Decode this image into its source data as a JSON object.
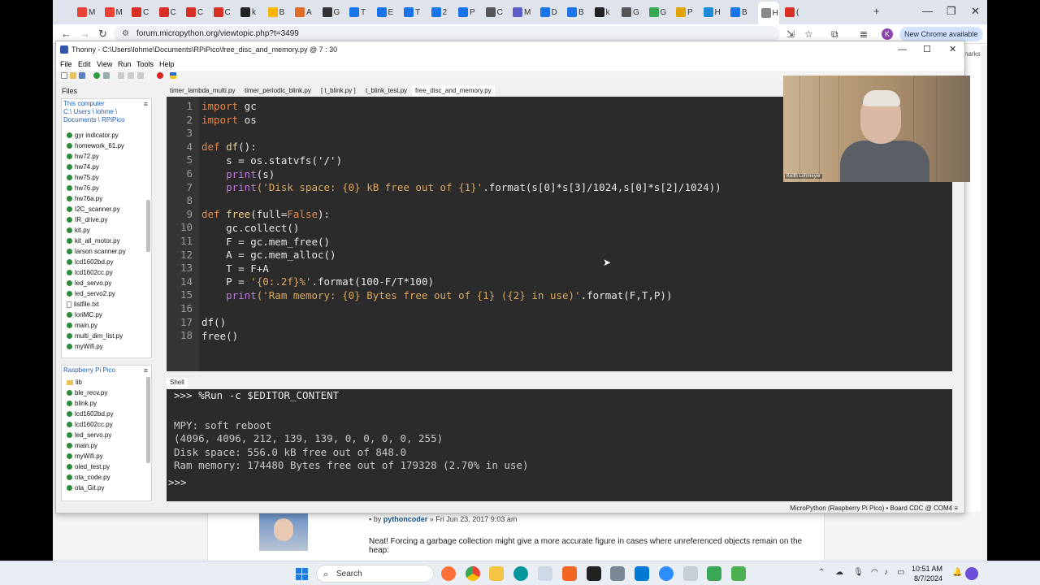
{
  "browser": {
    "url": "forum.micropython.org/viewtopic.php?t=3499",
    "new_chrome": "New Chrome available",
    "profile_initial": "K",
    "tabs": [
      "M",
      "M",
      "C",
      "C",
      "C",
      "C",
      "k",
      "B",
      "A",
      "G",
      "T",
      "E",
      "T",
      "2",
      "P",
      "C",
      "M",
      "D",
      "B",
      "k",
      "G",
      "G",
      "P",
      "H",
      "B",
      "H",
      "("
    ]
  },
  "forum": {
    "meta_by": "by",
    "meta_author": "pythoncoder",
    "meta_date": "» Fri Jun 23, 2017 9:03 am",
    "post_text": "Neat! Forcing a garbage collection might give a more accurate figure in cases where unreferenced objects remain on the heap:",
    "side_label": "narks"
  },
  "thonny": {
    "title": "Thonny  -  C:\\Users\\lohme\\Documents\\RPiPico\\free_disc_and_memory.py  @  7 : 30",
    "menu": [
      "File",
      "Edit",
      "View",
      "Run",
      "Tools",
      "Help"
    ],
    "files_header": "Files",
    "this_computer": {
      "title": "This computer",
      "path1": "C:\\ Users \\ lohme \\",
      "path2": "Documents \\ RPiPico",
      "files": [
        "gyr indicator.py",
        "homework_61.py",
        "hw72.py",
        "hw74.py",
        "hw75.py",
        "hw76.py",
        "hw76a.py",
        "I2C_scanner.py",
        "IR_drive.py",
        "kit.py",
        "kit_all_motor.py",
        "larson scanner.py",
        "lcd1602bd.py",
        "lcd1602cc.py",
        "led_servo.py",
        "led_servo2.py",
        "listfile.txt",
        "loriMC.py",
        "main.py",
        "multi_dim_list.py",
        "myWifi.py"
      ]
    },
    "pico": {
      "title": "Raspberry Pi Pico",
      "folder": "lib",
      "files": [
        "ble_recv.py",
        "blink.py",
        "lcd1602bd.py",
        "lcd1602cc.py",
        "led_servo.py",
        "main.py",
        "myWifi.py",
        "oled_test.py",
        "ota_code.py",
        "ota_Git.py"
      ]
    },
    "editor_tabs": [
      "timer_lambda_multi.py",
      "timer_periodic_blink.py",
      "[ t_blink.py ]",
      "t_blink_test.py",
      "free_disc_and_memory.py"
    ],
    "code_lines": [
      "1",
      "2",
      "3",
      "4",
      "5",
      "6",
      "7",
      "8",
      "9",
      "10",
      "11",
      "12",
      "13",
      "14",
      "15",
      "16",
      "17",
      "18"
    ],
    "code": {
      "l1_kw": "import",
      "l1_rest": " gc",
      "l2_kw": "import",
      "l2_rest": " os",
      "l4_kw": "def",
      "l4_fn": " df",
      "l4_rest": "():",
      "l5": "    s = os.statvfs('/')",
      "l6_bi": "    print",
      "l6_rest": "(s)",
      "l7_bi": "    print",
      "l7_st": "('Disk space: {0} kB free out of {1}'",
      "l7_rest": ".format(s[0]*s[3]/1024,s[0]*s[2]/1024))",
      "l9_kw": "def",
      "l9_fn": " free",
      "l9_a": "(full=",
      "l9_cn": "False",
      "l9_b": "):",
      "l10": "    gc.collect()",
      "l11": "    F = gc.mem_free()",
      "l12": "    A = gc.mem_alloc()",
      "l13": "    T = F+A",
      "l14_a": "    P = ",
      "l14_st": "'{0:.2f}%'",
      "l14_b": ".format(100-F/T*100)",
      "l15_bi": "    print",
      "l15_st": "('Ram memory: {0} Bytes free out of {1} ({2} in use)'",
      "l15_rest": ".format(F,T,P))",
      "l17": "df()",
      "l18": "free()"
    },
    "shell_tab": "Shell",
    "shell": {
      "cmd": ">>> %Run -c $EDITOR_CONTENT",
      "out1": "MPY: soft reboot",
      "out2": "(4096, 4096, 212, 139, 139, 0, 0, 0, 0, 255)",
      "out3": "Disk space: 556.0 kB free out of 848.0",
      "out4": "Ram memory: 174480 Bytes free out of 179328 (2.70% in use)",
      "prompt": ">>>"
    },
    "status": "MicroPython (Raspberry Pi Pico)  •  Board CDC @ COM4  ≡"
  },
  "webcam": {
    "name": "Keith Lohmeyer"
  },
  "taskbar": {
    "search": "Search",
    "time": "10:51 AM",
    "date": "8/7/2024"
  },
  "colors": {
    "editor_bg": "#2b2b2b",
    "keyword": "#e3874b",
    "string": "#d9a85f",
    "builtin": "#b97ad6"
  }
}
